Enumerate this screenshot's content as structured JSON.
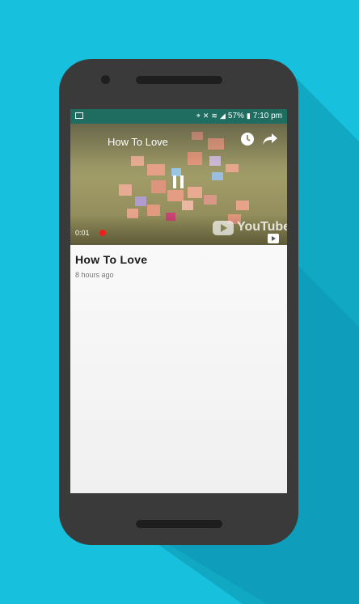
{
  "status_bar": {
    "battery": "57%",
    "time": "7:10 pm"
  },
  "video": {
    "title": "How To Love",
    "elapsed": "0:01",
    "watermark": "YouTube"
  },
  "content": {
    "title": "How To Love",
    "posted": "8 hours ago"
  },
  "colors": {
    "background": "#17c0dc",
    "status_bar": "#1f6d60",
    "scrub_dot": "#f21d1d"
  }
}
